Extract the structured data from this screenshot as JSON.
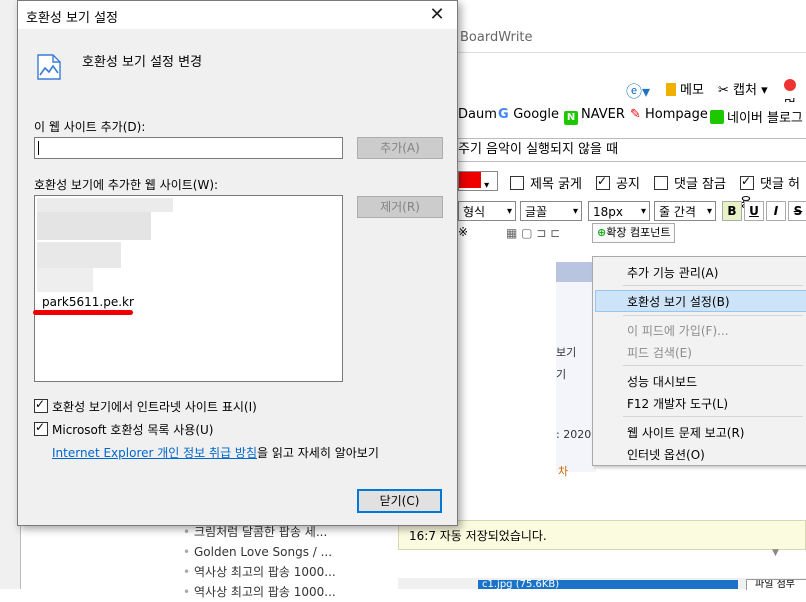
{
  "background": {
    "address_text": "BoardWrite",
    "toolbar": {
      "memo": "메모",
      "capture": "캡처",
      "last": "며"
    },
    "favorites": [
      "Daum",
      "Google",
      "NAVER",
      "Hompage",
      "네이버 블로그"
    ],
    "post_subject": "주기 음악이 실행되지 않을 때",
    "options": {
      "title_bold": "제목 굵게",
      "notice": "공지",
      "comment_lock": "댓글 잠금",
      "comment_allow": "댓글 허용"
    },
    "format": {
      "font_style": "형식",
      "font": "글꼴",
      "size": "18px",
      "line": "줄 간격",
      "bold": "B",
      "underline": "U",
      "italic": "I",
      "strike": "S",
      "extend": "확장 컴포넌트",
      "symbol": "※"
    },
    "preview_text": [
      "보기",
      "기",
      ": 2020",
      "차"
    ],
    "status": "16:7 자동 저장되었습니다.",
    "sidebar_links": [
      "크림처럼 달콤한 팝송 세...",
      "Golden Love Songs / ...",
      "역사상 최고의 팝송 1000...",
      "역사상 최고의 팝송 1000..."
    ],
    "file_item": "c1.jpg (75.6KB)",
    "file_button": "파일 첨부"
  },
  "context_menu": {
    "items": [
      "추가 기능 관리(A)",
      "호환성 보기 설정(B)",
      "이 피드에 가입(F)...",
      "피드 검색(E)",
      "성능 대시보드",
      "F12 개발자 도구(L)",
      "웹 사이트 문제 보고(R)",
      "인터넷 옵션(O)"
    ],
    "highlighted_index": 1,
    "disabled_indices": [
      2,
      3
    ]
  },
  "dialog": {
    "title": "호환성 보기 설정",
    "heading": "호환성 보기 설정 변경",
    "add_label": "이 웹 사이트 추가(D):",
    "add_input_value": "",
    "add_button": "추가(A)",
    "list_label": "호환성 보기에 추가한 웹 사이트(W):",
    "sites": [
      "park5611.pe.kr"
    ],
    "remove_button": "제거(R)",
    "check_intranet": "호환성 보기에서 인트라넷 사이트 표시(I)",
    "check_microsoft": "Microsoft 호환성 목록 사용(U)",
    "privacy_link": "Internet Explorer 개인 정보 취급 방침",
    "privacy_suffix": "을 읽고 자세히 알아보기",
    "close_button": "닫기(C)"
  },
  "colors": {
    "accent": "#0078d7",
    "link": "#0066cc",
    "highlight": "#cde3f7",
    "annotation": "#ee0000"
  }
}
